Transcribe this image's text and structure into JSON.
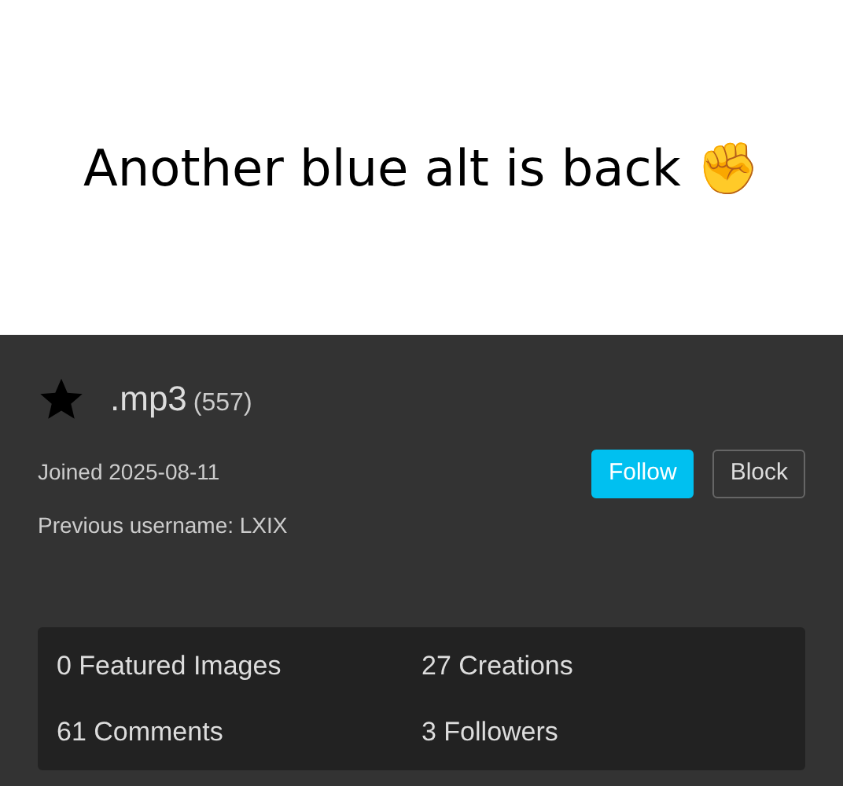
{
  "caption": "Another blue alt is back ✊",
  "profile": {
    "username": ".mp3",
    "points": "(557)",
    "joined": "Joined 2025-08-11",
    "previous_username": "Previous username: LXIX",
    "buttons": [
      {
        "label": "Follow",
        "kind": "primary"
      },
      {
        "label": "Block",
        "kind": "outline"
      }
    ]
  },
  "stats": [
    "0 Featured Images",
    "27 Creations",
    "61 Comments",
    "3 Followers"
  ]
}
